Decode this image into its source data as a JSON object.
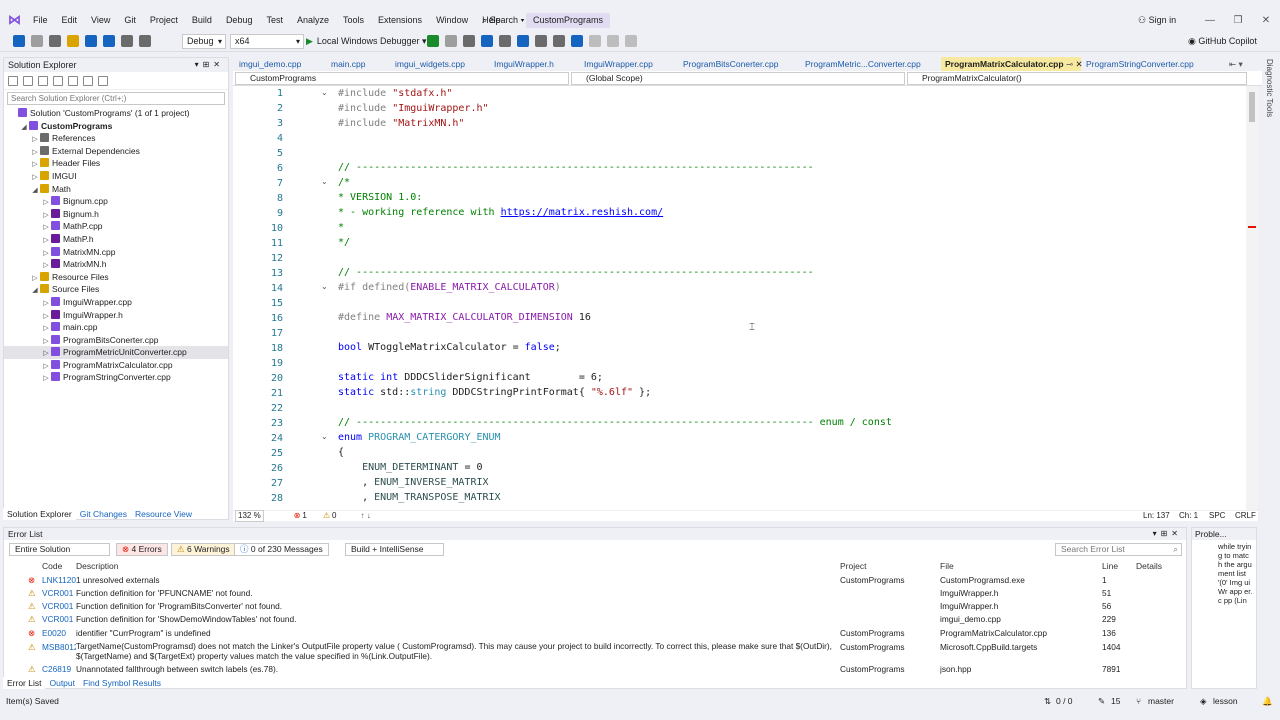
{
  "menu": [
    "File",
    "Edit",
    "View",
    "Git",
    "Project",
    "Build",
    "Debug",
    "Test",
    "Analyze",
    "Tools",
    "Extensions",
    "Window",
    "Help"
  ],
  "search_label": "Search",
  "app_title": "CustomPrograms",
  "signin": "Sign in",
  "toolbar": {
    "config": "Debug",
    "platform": "x64",
    "run": "Local Windows Debugger",
    "copilot": "GitHub Copilot"
  },
  "solution_explorer": {
    "title": "Solution Explorer",
    "search_placeholder": "Search Solution Explorer (Ctrl+;)",
    "items": [
      {
        "label": "Solution 'CustomPrograms' (1 of 1 project)",
        "depth": 0
      },
      {
        "label": "CustomPrograms",
        "depth": 1,
        "bold": true
      },
      {
        "label": "References",
        "depth": 2
      },
      {
        "label": "External Dependencies",
        "depth": 2
      },
      {
        "label": "Header Files",
        "depth": 2
      },
      {
        "label": "IMGUI",
        "depth": 2
      },
      {
        "label": "Math",
        "depth": 2
      },
      {
        "label": "Bignum.cpp",
        "depth": 3
      },
      {
        "label": "Bignum.h",
        "depth": 3
      },
      {
        "label": "MathP.cpp",
        "depth": 3
      },
      {
        "label": "MathP.h",
        "depth": 3
      },
      {
        "label": "MatrixMN.cpp",
        "depth": 3
      },
      {
        "label": "MatrixMN.h",
        "depth": 3
      },
      {
        "label": "Resource Files",
        "depth": 2
      },
      {
        "label": "Source Files",
        "depth": 2
      },
      {
        "label": "ImguiWrapper.cpp",
        "depth": 3
      },
      {
        "label": "ImguiWrapper.h",
        "depth": 3
      },
      {
        "label": "main.cpp",
        "depth": 3
      },
      {
        "label": "ProgramBitsConerter.cpp",
        "depth": 3
      },
      {
        "label": "ProgramMetricUnitConverter.cpp",
        "depth": 3,
        "selected": true
      },
      {
        "label": "ProgramMatrixCalculator.cpp",
        "depth": 3
      },
      {
        "label": "ProgramStringConverter.cpp",
        "depth": 3
      }
    ],
    "footer_tabs": [
      "Solution Explorer",
      "Git Changes",
      "Resource View"
    ]
  },
  "tabs": [
    "imgui_demo.cpp",
    "main.cpp",
    "imgui_widgets.cpp",
    "ImguiWrapper.h",
    "ImguiWrapper.cpp",
    "ProgramBitsConerter.cpp",
    "ProgramMetric...Converter.cpp",
    "ProgramMatrixCalculator.cpp",
    "ProgramStringConverter.cpp"
  ],
  "active_tab": "ProgramMatrixCalculator.cpp",
  "nav": {
    "project": "CustomPrograms",
    "scope": "(Global Scope)",
    "member": "ProgramMatrixCalculator()"
  },
  "editor": {
    "line_numbers": [
      "1",
      "2",
      "3",
      "4",
      "5",
      "6",
      "7",
      "8",
      "9",
      "10",
      "11",
      "12",
      "13",
      "14",
      "15",
      "16",
      "17",
      "18",
      "19",
      "20",
      "21",
      "22",
      "23",
      "24",
      "25",
      "26",
      "27",
      "28"
    ],
    "zoom": "132 %",
    "errors": "1",
    "warnings": "0",
    "position": "Ln: 137",
    "col": "Ch: 1",
    "ws": "SPC",
    "eol": "CRLF"
  },
  "error_list": {
    "title": "Error List",
    "scope": "Entire Solution",
    "errors_btn": "4 Errors",
    "warnings_btn": "6 Warnings",
    "messages_btn": "0 of 230 Messages",
    "build_filter": "Build + IntelliSense",
    "search_placeholder": "Search Error List",
    "columns": [
      "Code",
      "Description",
      "Project",
      "File",
      "Line",
      "Details"
    ],
    "rows": [
      {
        "type": "error",
        "code": "LNK1120",
        "desc": "1 unresolved externals",
        "project": "CustomPrograms",
        "file": "CustomProgramsd.exe",
        "line": "1"
      },
      {
        "type": "warning",
        "code": "VCR001",
        "desc": "Function definition for 'PFUNCNAME' not found.",
        "project": "",
        "file": "ImguiWrapper.h",
        "line": "51"
      },
      {
        "type": "warning",
        "code": "VCR001",
        "desc": "Function definition for 'ProgramBitsConverter' not found.",
        "project": "",
        "file": "ImguiWrapper.h",
        "line": "56"
      },
      {
        "type": "warning",
        "code": "VCR001",
        "desc": "Function definition for 'ShowDemoWindowTables' not found.",
        "project": "",
        "file": "imgui_demo.cpp",
        "line": "229"
      },
      {
        "type": "error",
        "code": "E0020",
        "desc": "identifier \"CurrProgram\" is undefined",
        "project": "CustomPrograms",
        "file": "ProgramMatrixCalculator.cpp",
        "line": "136"
      },
      {
        "type": "warning",
        "code": "MSB8012",
        "desc": "TargetName(CustomProgramsd) does not match the Linker's OutputFile property value ( CustomProgramsd). This may cause your project to build incorrectly. To correct this, please make sure that $(OutDir), $(TargetName) and $(TargetExt) property values match the value specified in %(Link.OutputFile).",
        "project": "CustomPrograms",
        "file": "Microsoft.CppBuild.targets",
        "line": "1404"
      },
      {
        "type": "warning",
        "code": "C26819",
        "desc": "Unannotated fallthrough between switch labels (es.78).",
        "project": "CustomPrograms",
        "file": "json.hpp",
        "line": "7891"
      }
    ],
    "footer_tabs": [
      "Error List",
      "Output",
      "Find Symbol Results"
    ]
  },
  "problem_details": {
    "title": "Proble...",
    "text": "while tryin g to matc h the argu ment list '(0' Img uiWr app er.c pp (Lin"
  },
  "right_strip": "Diagnostic Tools",
  "status": {
    "left": "Item(s) Saved",
    "updown": "0 / 0",
    "pencil": "15",
    "branch": "master",
    "repo": "lesson"
  },
  "colors": {
    "accent": "#8250df",
    "error": "#e51400",
    "warning": "#c68b00",
    "active_tab": "#f7e9a0"
  }
}
